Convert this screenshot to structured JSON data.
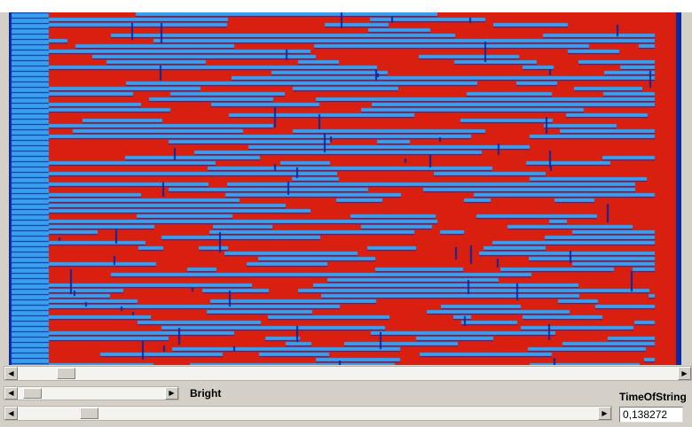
{
  "bright": {
    "label": "Bright",
    "level": 0.04
  },
  "time_of_string": {
    "label": "TimeOfString",
    "value": "0,138272",
    "level": 0.11
  },
  "image_scroll": {
    "level": 0.06
  },
  "icons": {
    "left_arrow": "left-arrow-icon",
    "right_arrow": "right-arrow-icon"
  },
  "colors": {
    "red": "#d81f10",
    "blue": "#3aa0ee",
    "dark_blue": "#0a2aa0",
    "window": "#d4d0c8"
  }
}
